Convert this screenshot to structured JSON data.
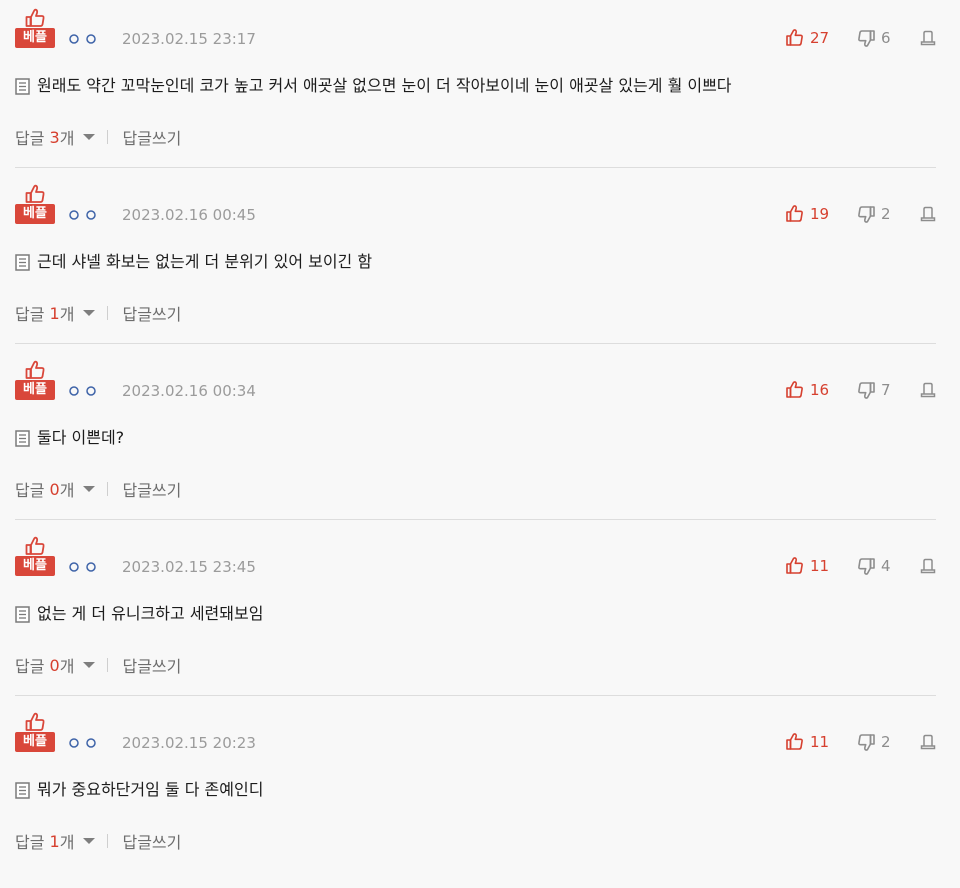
{
  "labels": {
    "best_badge": "베플",
    "reply": "답글",
    "reply_unit": "개",
    "write_reply": "답글쓰기"
  },
  "colors": {
    "accent_red": "#d9473a",
    "text": "#1c1c1c",
    "muted": "#9b9b9b",
    "divider": "#dddddd",
    "background": "#f8f8f8"
  },
  "icons": {
    "best": "thumbs-up-icon",
    "like": "thumbs-up-icon",
    "dislike": "thumbs-down-icon",
    "report": "report-icon",
    "comment": "document-icon",
    "expand": "chevron-down-icon"
  },
  "comments": [
    {
      "date": "2023.02.15 23:17",
      "likes": "27",
      "dislikes": "6",
      "text": "원래도 약간 꼬막눈인데 코가 높고 커서 애굣살 없으면 눈이 더 작아보이네 눈이 애굣살 있는게 훨 이쁘다",
      "reply_count": "3"
    },
    {
      "date": "2023.02.16 00:45",
      "likes": "19",
      "dislikes": "2",
      "text": "근데 샤넬 화보는 없는게 더 분위기 있어 보이긴 함",
      "reply_count": "1"
    },
    {
      "date": "2023.02.16 00:34",
      "likes": "16",
      "dislikes": "7",
      "text": "둘다 이쁜데?",
      "reply_count": "0"
    },
    {
      "date": "2023.02.15 23:45",
      "likes": "11",
      "dislikes": "4",
      "text": "없는 게 더 유니크하고 세련돼보임",
      "reply_count": "0"
    },
    {
      "date": "2023.02.15 20:23",
      "likes": "11",
      "dislikes": "2",
      "text": "뭐가 중요하단거임 둘 다 존예인디",
      "reply_count": "1"
    }
  ]
}
